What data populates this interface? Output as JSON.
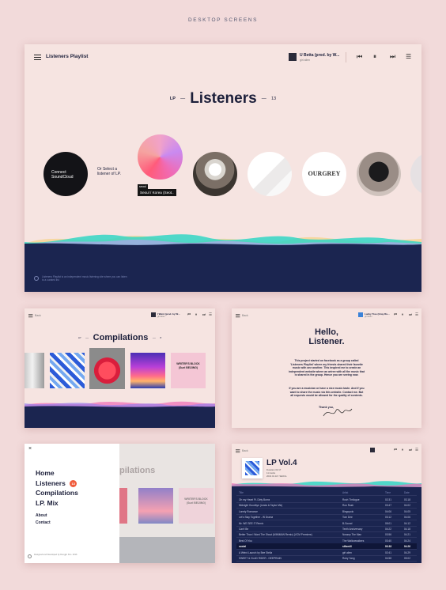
{
  "page": {
    "heading": "DESKTOP SCREENS"
  },
  "main_screen": {
    "app_title": "Listeners Playlist",
    "now_playing": {
      "title": "U Betta (prod. by W...",
      "artist": "girl alien"
    },
    "controls": [
      "prev-icon",
      "pause-icon",
      "next-icon",
      "queue-icon"
    ],
    "title_prefix": "LP",
    "title": "Listeners",
    "title_count": "13",
    "connect_label": "Connect SoundCloud",
    "select_label": "Or Select a listener of LP.",
    "tooltip": {
      "tag": "seoul",
      "location": "Seoul / Korea (Seot.."
    },
    "listener_tiles": [
      "pink-gradient",
      "stormtrooper",
      "white-paper",
      "ourgrey",
      "black-cat",
      "partial"
    ],
    "ourgrey_text": "OURGREY",
    "footer_text": "Listeners Playlist is an independent music listening site where you can listen to a curated list"
  },
  "compilations_screen": {
    "back": "Back",
    "now_playing": {
      "title": "I Want (prod. by W...",
      "artist": "girl alien"
    },
    "title_prefix": "LP",
    "title": "Compilations",
    "title_suffix": "8",
    "album_text": "WRITER'S BLOCK (Suel BEIJING)"
  },
  "about_screen": {
    "back": "Back",
    "now_playing": {
      "title": "Lucky Tree (Gray Ru...",
      "artist": "girl alien"
    },
    "heading_line1": "Hello,",
    "heading_line2": "Listener.",
    "paragraph1": "This project started on facebook as a group called 'Listeners Playlist' where my friends shared their favorite music with one another. This inspired me to create an independent website where an artree with all the music that is shared in the group. Hence you are seeing now.",
    "paragraph2": "If you are a musician or have a nice music taste. And if you want to share the music via this website. Contact me. But all requests would be allowed for the quality of contents.",
    "thanks": "Thank you,"
  },
  "menu_screen": {
    "close": "×",
    "items": [
      "Home",
      "Listeners",
      "Compilations",
      "LP. Mix"
    ],
    "listeners_badge": "13",
    "secondary": [
      "About",
      "Contact"
    ],
    "footer": "Designed and Developed by Dongjin Kim. 2016",
    "bg_title": "pilations",
    "bg_album_text": "WRITER'S BLOCK (Suel BEIJING)"
  },
  "playlist_screen": {
    "back": "Back",
    "title": "LP Vol.4",
    "meta": [
      "Duration 02:17",
      "11 tracks",
      "2016.01.18 / SEOUL"
    ],
    "headers": [
      "Title",
      "Artist",
      "Time",
      "Date"
    ],
    "tracks": [
      [
        "Oh my Heart Ft. Dirty Burns",
        "Rush Thrilogue",
        "02:31",
        "03.18"
      ],
      [
        "Midnight Goodbye (Lewis & Taylor Mix)",
        "Ron Rush",
        "03:47",
        "04.02"
      ],
      [
        "Lonely Romance",
        "Bingopolo",
        "04:06",
        "04.05"
      ],
      [
        "Let's Stay Together - W Drama",
        "Tom Dee",
        "03:12",
        "04.06"
      ],
      [
        "Mr. WE SEE IT Remix",
        "B-Sound",
        "05:01",
        "04.12"
      ],
      [
        "Can't Be",
        "Tenth Anniversary",
        "04:22",
        "04.18"
      ],
      [
        "Better Than I Want The Shout (MINIMAN Remix) (VCM Premiere)",
        "Nossey The Man",
        "03:56",
        "04.21"
      ],
      [
        "Best Of You",
        "The Wallowwalkers",
        "03:40",
        "04.24"
      ],
      [
        "social",
        "sillsmill",
        "03:33",
        "04.26"
      ],
      [
        "A Weird Launch by Bee Stella",
        "girl alien",
        "02:41",
        "04.29"
      ],
      [
        "SWEET & GLAD RIDER - DEEPRAIN",
        "Ruby Yang",
        "04:58",
        "05.02"
      ]
    ],
    "active_index": 8
  },
  "colors": {
    "background": "#f2dada",
    "screen": "#f6e4e1",
    "navy": "#1b2550",
    "wave_teal": "#33d6c4",
    "wave_pink": "#f06bb5",
    "wave_yellow": "#f5d38a",
    "wave_purple": "#8b7bf0",
    "badge": "#f05b3b"
  }
}
